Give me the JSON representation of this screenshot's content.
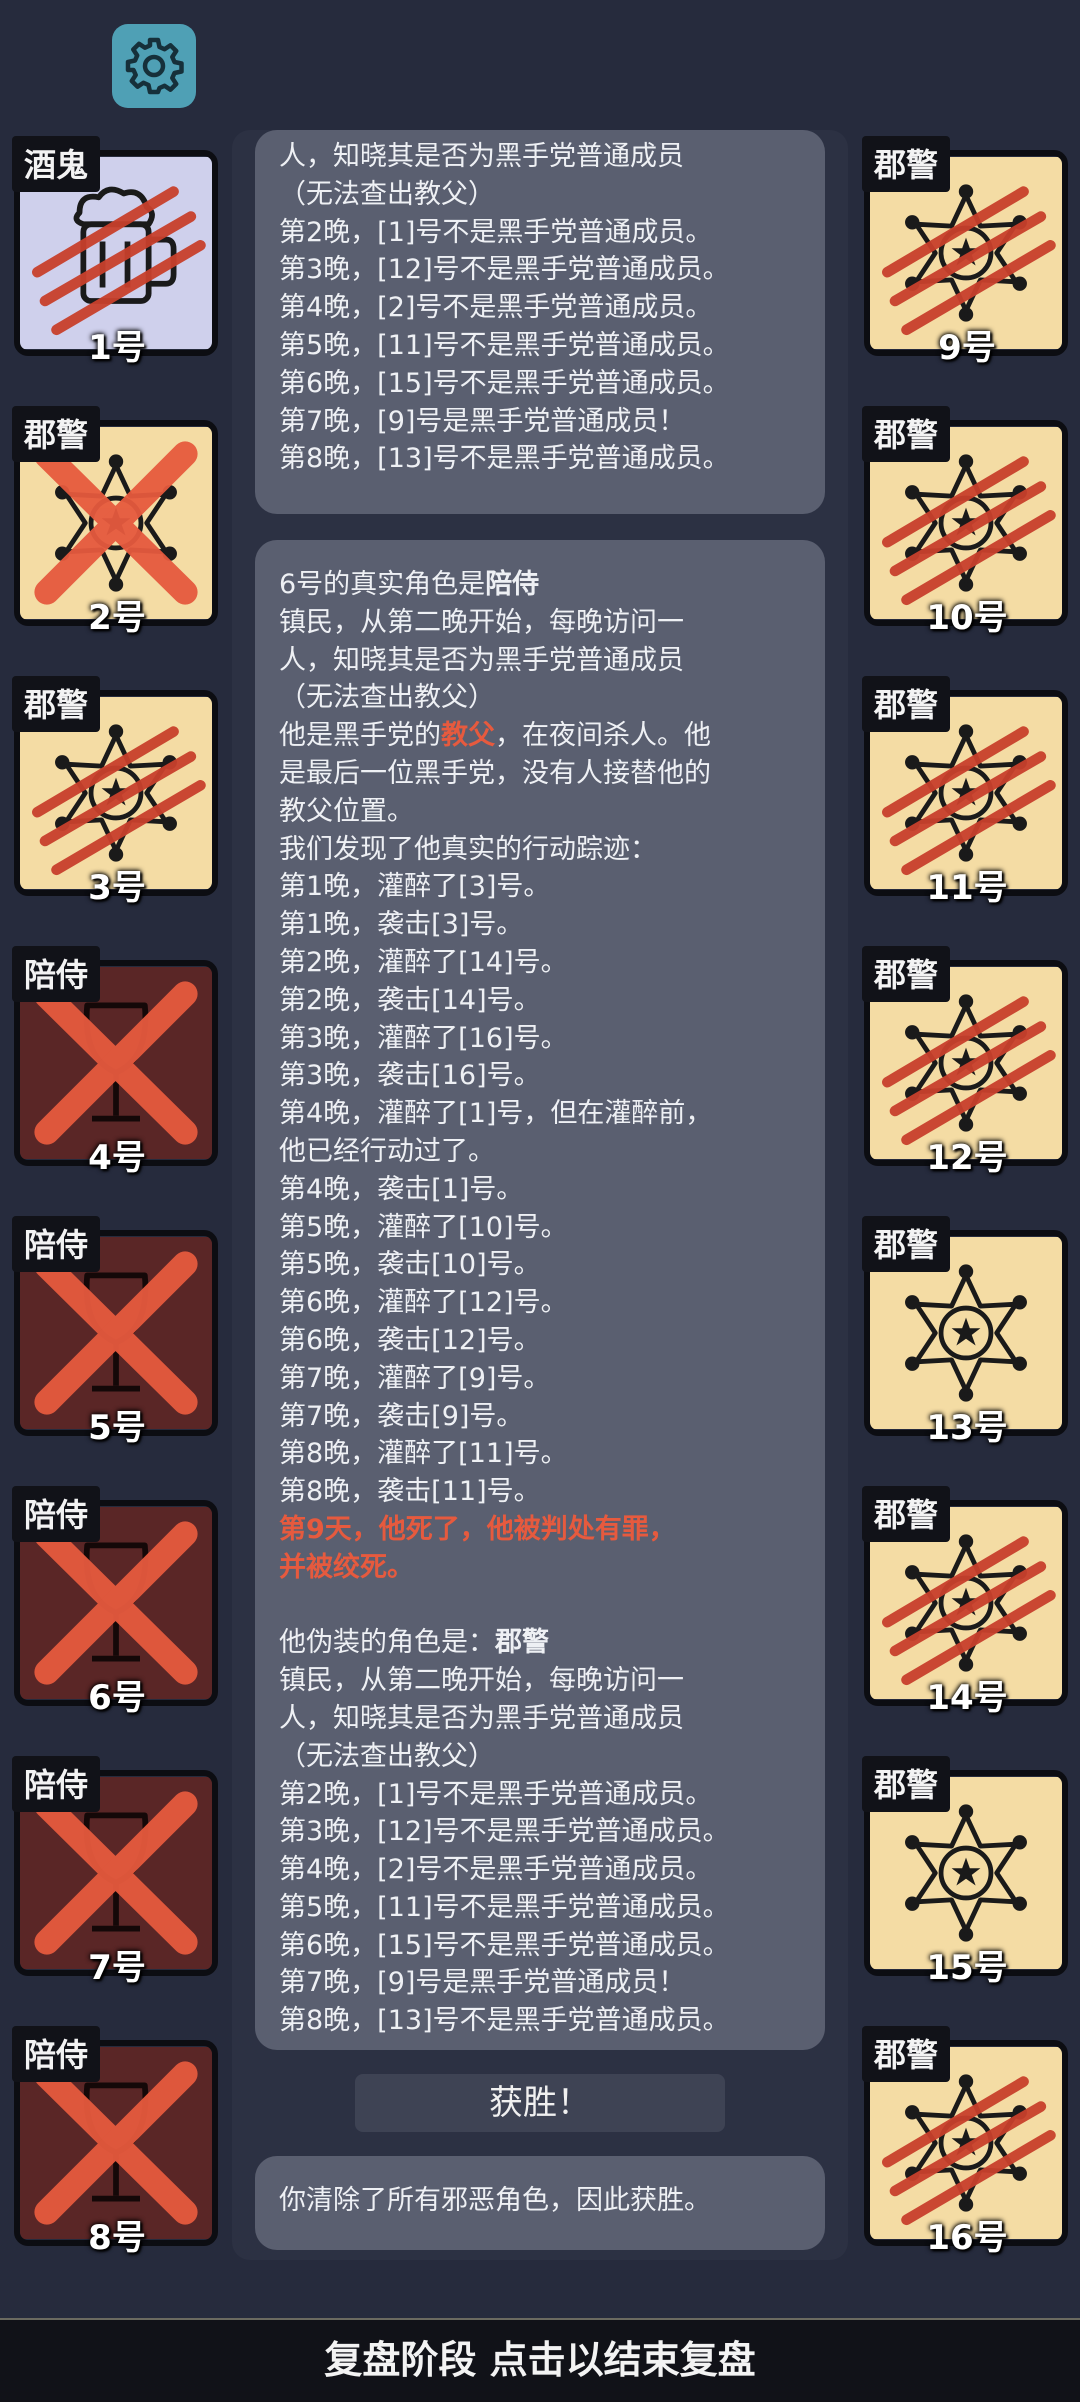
{
  "header": {
    "settings_icon": "gear-icon"
  },
  "players": {
    "left": [
      {
        "number": "1号",
        "role": "酒鬼",
        "icon": "beer-mug",
        "state": "clawed"
      },
      {
        "number": "2号",
        "role": "郡警",
        "icon": "sheriff-star",
        "state": "crossed"
      },
      {
        "number": "3号",
        "role": "郡警",
        "icon": "sheriff-star",
        "state": "clawed"
      },
      {
        "number": "4号",
        "role": "陪侍",
        "icon": "wine-glass",
        "state": "crossed"
      },
      {
        "number": "5号",
        "role": "陪侍",
        "icon": "wine-glass",
        "state": "crossed"
      },
      {
        "number": "6号",
        "role": "陪侍",
        "icon": "wine-glass",
        "state": "crossed"
      },
      {
        "number": "7号",
        "role": "陪侍",
        "icon": "wine-glass",
        "state": "crossed"
      },
      {
        "number": "8号",
        "role": "陪侍",
        "icon": "wine-glass",
        "state": "crossed"
      }
    ],
    "right": [
      {
        "number": "9号",
        "role": "郡警",
        "icon": "sheriff-star",
        "state": "clawed"
      },
      {
        "number": "10号",
        "role": "郡警",
        "icon": "sheriff-star",
        "state": "clawed"
      },
      {
        "number": "11号",
        "role": "郡警",
        "icon": "sheriff-star",
        "state": "clawed"
      },
      {
        "number": "12号",
        "role": "郡警",
        "icon": "sheriff-star",
        "state": "clawed"
      },
      {
        "number": "13号",
        "role": "郡警",
        "icon": "sheriff-star",
        "state": "alive"
      },
      {
        "number": "14号",
        "role": "郡警",
        "icon": "sheriff-star",
        "state": "clawed"
      },
      {
        "number": "15号",
        "role": "郡警",
        "icon": "sheriff-star",
        "state": "alive"
      },
      {
        "number": "16号",
        "role": "郡警",
        "icon": "sheriff-star",
        "state": "clawed"
      }
    ]
  },
  "log_top": [
    "人，知晓其是否为黑手党普通成员",
    "（无法查出教父）",
    "第2晚，[1]号不是黑手党普通成员。",
    "第3晚，[12]号不是黑手党普通成员。",
    "第4晚，[2]号不是黑手党普通成员。",
    "第5晚，[11]号不是黑手党普通成员。",
    "第6晚，[15]号不是黑手党普通成员。",
    "第7晚，[9]号是黑手党普通成员！",
    "第8晚，[13]号不是黑手党普通成员。"
  ],
  "log_main": {
    "true_role_prefix": "6号的真实角色是",
    "true_role": "陪侍",
    "role_desc": [
      "镇民，从第二晚开始，每晚访问一",
      "人，知晓其是否为黑手党普通成员",
      "（无法查出教父）"
    ],
    "godfather_prefix": "他是黑手党的",
    "godfather": "教父",
    "godfather_suffix": "，在夜间杀人。他",
    "godfather_lines": [
      "是最后一位黑手党，没有人接替他的",
      "教父位置。"
    ],
    "tracks_intro": "我们发现了他真实的行动踪迹：",
    "tracks": [
      "第1晚，灌醉了[3]号。",
      "第1晚，袭击[3]号。",
      "第2晚，灌醉了[14]号。",
      "第2晚，袭击[14]号。",
      "第3晚，灌醉了[16]号。",
      "第3晚，袭击[16]号。",
      "第4晚，灌醉了[1]号，但在灌醉前，",
      "他已经行动过了。",
      "第4晚，袭击[1]号。",
      "第5晚，灌醉了[10]号。",
      "第5晚，袭击[10]号。",
      "第6晚，灌醉了[12]号。",
      "第6晚，袭击[12]号。",
      "第7晚，灌醉了[9]号。",
      "第7晚，袭击[9]号。",
      "第8晚，灌醉了[11]号。",
      "第8晚，袭击[11]号。"
    ],
    "death": [
      "第9天，他死了，他被判处有罪，",
      "并被绞死。"
    ],
    "disguise_prefix": "他伪装的角色是：",
    "disguise": "郡警",
    "disguise_desc": [
      "镇民，从第二晚开始，每晚访问一",
      "人，知晓其是否为黑手党普通成员",
      "（无法查出教父）"
    ],
    "disguise_results": [
      "第2晚，[1]号不是黑手党普通成员。",
      "第3晚，[12]号不是黑手党普通成员。",
      "第4晚，[2]号不是黑手党普通成员。",
      "第5晚，[11]号不是黑手党普通成员。",
      "第6晚，[15]号不是黑手党普通成员。",
      "第7晚，[9]号是黑手党普通成员！",
      "第8晚，[13]号不是黑手党普通成员。"
    ]
  },
  "victory_label": "获胜！",
  "victory_message": "你清除了所有邪恶角色，因此获胜。",
  "footer": "复盘阶段 点击以结束复盘",
  "colors": {
    "background": "#262b3d",
    "panel": "#5a5f70",
    "highlight": "#e65a3e",
    "sheriff_tile": "#f4dca4",
    "escort_tile": "#5a2626",
    "drunk_tile": "#cfd0ec"
  }
}
